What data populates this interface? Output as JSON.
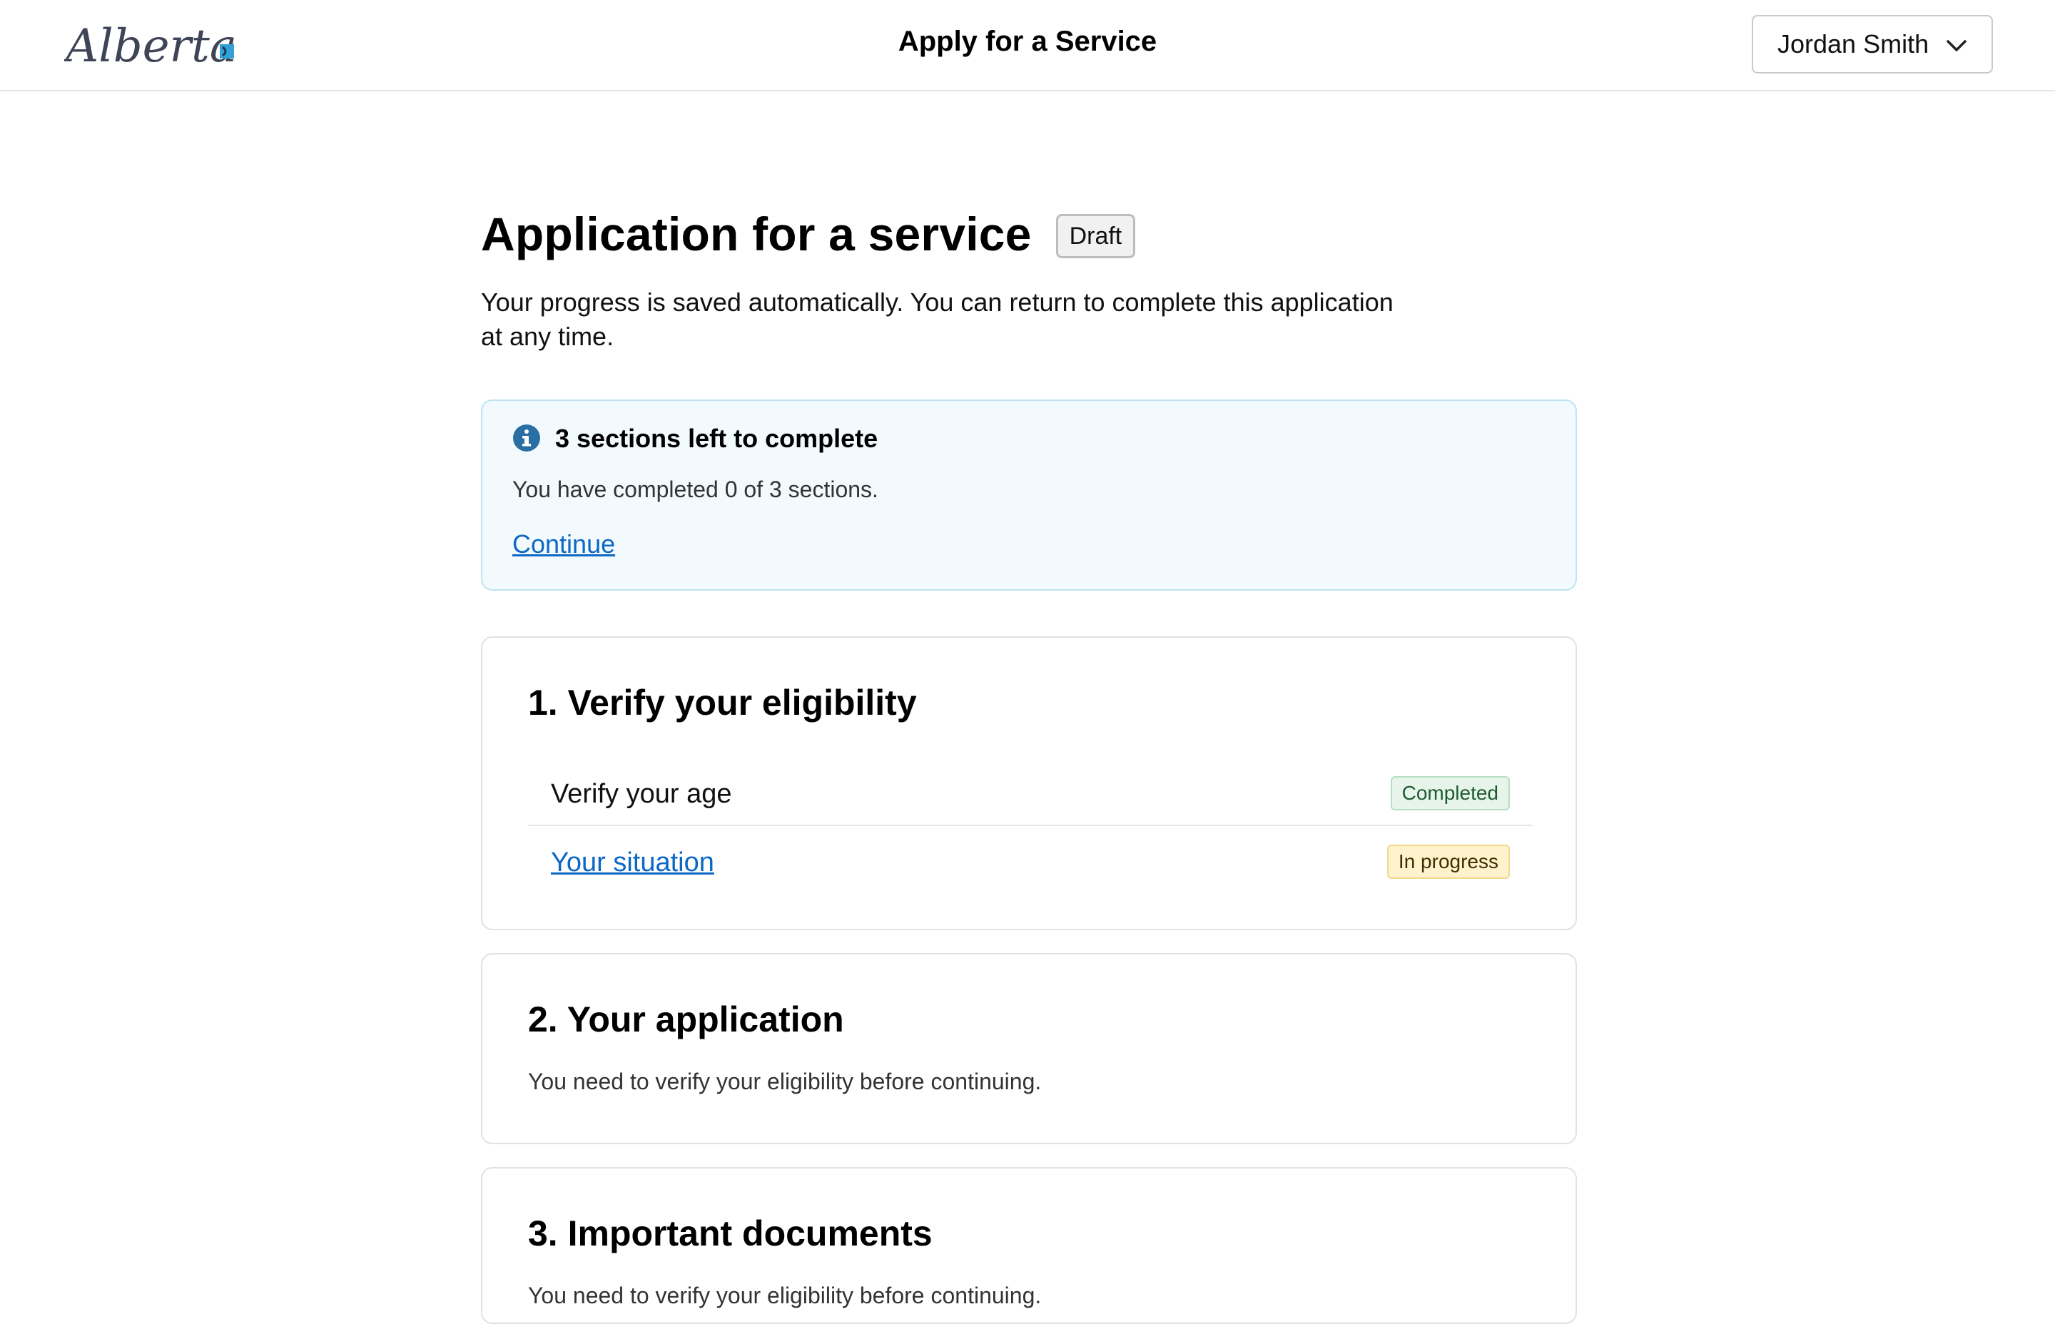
{
  "header": {
    "logo_text": "Alberta",
    "app_title": "Apply for a Service",
    "user_name": "Jordan Smith"
  },
  "page": {
    "title": "Application for a service",
    "status_badge": "Draft",
    "intro": "Your progress is saved automatically. You can return to complete this application at any time."
  },
  "callout": {
    "heading": "3 sections left to complete",
    "text": "You have completed 0 of 3 sections.",
    "link": "Continue"
  },
  "sections": [
    {
      "title": "1. Verify your eligibility",
      "tasks": [
        {
          "label": "Verify your age",
          "status": "Completed"
        },
        {
          "label": "Your situation",
          "status": "In progress"
        }
      ]
    },
    {
      "title": "2. Your application",
      "message": "You need to verify your eligibility before continuing."
    },
    {
      "title": "3. Important documents",
      "message": "You need to verify your eligibility before continuing."
    }
  ],
  "colors": {
    "link": "#0b68c4",
    "info_icon": "#2a6fa3",
    "callout_bg": "#f2fafd",
    "completed_bg": "#e6f4ea",
    "in_progress_bg": "#fff3cd"
  },
  "icons": {
    "info": "info-icon",
    "user_menu": "chevron-down-icon"
  }
}
